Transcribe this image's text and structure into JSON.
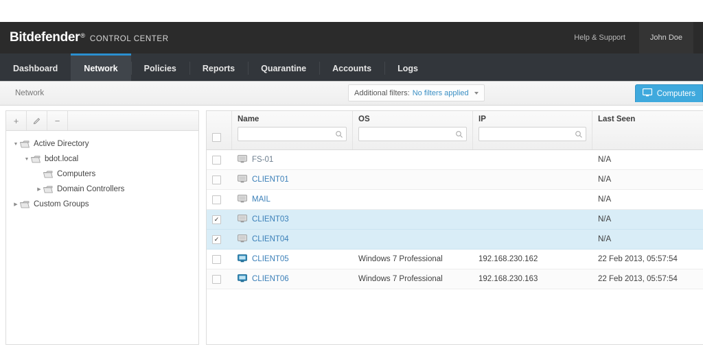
{
  "header": {
    "logo_main": "Bitdefender",
    "logo_reg": "®",
    "logo_sub": "CONTROL CENTER",
    "help_link": "Help & Support",
    "user_name": "John Doe",
    "bg_color": "#2b2b2b"
  },
  "nav": {
    "accent_color": "#2a8fd0",
    "items": [
      {
        "label": "Dashboard",
        "active": false
      },
      {
        "label": "Network",
        "active": true
      },
      {
        "label": "Policies",
        "active": false
      },
      {
        "label": "Reports",
        "active": false
      },
      {
        "label": "Quarantine",
        "active": false
      },
      {
        "label": "Accounts",
        "active": false
      },
      {
        "label": "Logs",
        "active": false
      }
    ]
  },
  "subbar": {
    "breadcrumb": "Network",
    "filters_label": "Additional filters:",
    "filters_value": "No filters applied",
    "view_button": "Computers",
    "view_button_color": "#3fa9dd"
  },
  "tree": {
    "toolbar": [
      {
        "name": "add-group-button",
        "glyph": "+"
      },
      {
        "name": "edit-group-button",
        "glyph": "✐"
      },
      {
        "name": "remove-group-button",
        "glyph": "−"
      }
    ],
    "nodes": [
      {
        "label": "Active Directory",
        "level": 1,
        "arrow": "down"
      },
      {
        "label": "bdot.local",
        "level": 2,
        "arrow": "down"
      },
      {
        "label": "Computers",
        "level": 3,
        "arrow": "none"
      },
      {
        "label": "Domain Controllers",
        "level": 3,
        "arrow": "right"
      },
      {
        "label": "Custom Groups",
        "level": 1,
        "arrow": "right"
      }
    ]
  },
  "table": {
    "columns": [
      {
        "key": "name",
        "label": "Name",
        "search": true,
        "search_value": ""
      },
      {
        "key": "os",
        "label": "OS",
        "search": true,
        "search_value": ""
      },
      {
        "key": "ip",
        "label": "IP",
        "search": true,
        "search_value": ""
      },
      {
        "key": "last_seen",
        "label": "Last Seen",
        "search": false,
        "search_value": ""
      }
    ],
    "select_all_checked": false,
    "rows": [
      {
        "name": "FS-01",
        "os": "",
        "ip": "",
        "last_seen": "N/A",
        "checked": false,
        "online": false
      },
      {
        "name": "CLIENT01",
        "os": "",
        "ip": "",
        "last_seen": "N/A",
        "checked": false,
        "online": false
      },
      {
        "name": "MAIL",
        "os": "",
        "ip": "",
        "last_seen": "N/A",
        "checked": false,
        "online": false
      },
      {
        "name": "CLIENT03",
        "os": "",
        "ip": "",
        "last_seen": "N/A",
        "checked": true,
        "online": false
      },
      {
        "name": "CLIENT04",
        "os": "",
        "ip": "",
        "last_seen": "N/A",
        "checked": true,
        "online": false
      },
      {
        "name": "CLIENT05",
        "os": "Windows 7 Professional",
        "ip": "192.168.230.162",
        "last_seen": "22 Feb 2013, 05:57:54",
        "checked": false,
        "online": true
      },
      {
        "name": "CLIENT06",
        "os": "Windows 7 Professional",
        "ip": "192.168.230.163",
        "last_seen": "22 Feb 2013, 05:57:54",
        "checked": false,
        "online": true
      }
    ]
  }
}
